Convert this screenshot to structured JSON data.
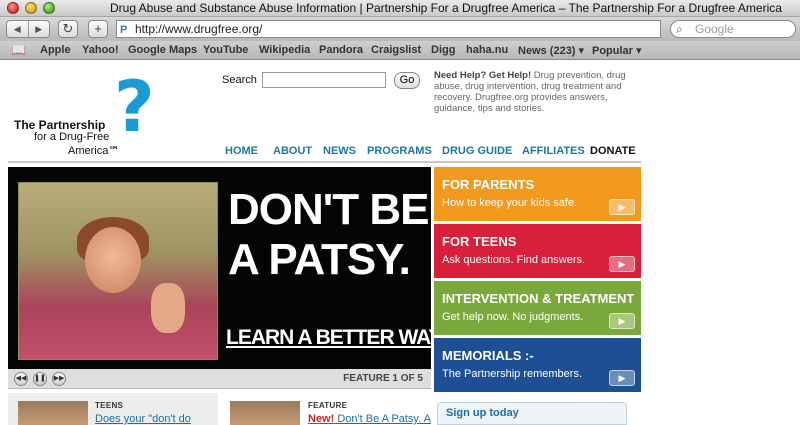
{
  "browser": {
    "window_title": "Drug Abuse and Substance Abuse Information | Partnership For a Drugfree America – The Partnership For a Drugfree America",
    "url": "http://www.drugfree.org/",
    "search_placeholder": "Google",
    "back_icon": "back-arrow-icon",
    "forward_icon": "forward-arrow-icon",
    "bookmarks": [
      "Apple",
      "Yahoo!",
      "Google Maps",
      "YouTube",
      "Wikipedia",
      "Pandora",
      "Craigslist",
      "Digg",
      "haha.nu",
      "News (223) ▾",
      "Popular ▾"
    ]
  },
  "logo": {
    "mark": "?",
    "line1": "The Partnership",
    "line2": "for a Drug-Free",
    "line3": "America℠"
  },
  "site_search": {
    "label": "Search",
    "value": "",
    "button": "Go"
  },
  "help": {
    "heading": "Need Help? Get Help!",
    "text": "Drug prevention, drug abuse, drug intervention, drug treatment and recovery. Drugfree.org provides answers, guidance, tips and stories."
  },
  "nav": {
    "items": [
      "HOME",
      "ABOUT",
      "NEWS",
      "PROGRAMS",
      "DRUG GUIDE",
      "AFFILIATES",
      "DONATE"
    ]
  },
  "hero": {
    "headline1": "DON'T BE",
    "headline2": "A PATSY.",
    "cta": "LEARN A BETTER WAY.",
    "feature_counter": "FEATURE 1 OF 5",
    "controls": [
      "rewind-icon",
      "pause-icon",
      "fast-forward-icon"
    ]
  },
  "tiles": [
    {
      "title": "FOR PARENTS",
      "subtitle": "How to keep your kids safe.",
      "color": "#f39a1e"
    },
    {
      "title": "FOR TEENS",
      "subtitle": "Ask questions. Find answers.",
      "color": "#d9203a"
    },
    {
      "title": "INTERVENTION & TREATMENT",
      "subtitle": "Get help now. No judgments.",
      "color": "#7aa83a"
    },
    {
      "title": "MEMORIALS :-",
      "subtitle": "The Partnership remembers.",
      "color": "#1e4f94"
    }
  ],
  "bottom": {
    "teens_label": "TEENS",
    "teens_link": "Does your \"don't do",
    "feature_label": "FEATURE",
    "feature_new": "New!",
    "feature_link": "Don't Be A Patsy. A",
    "signup": "Sign up today"
  },
  "colors": {
    "nav_blue": "#1a78a8",
    "logo_blue": "#1b9bd6"
  }
}
